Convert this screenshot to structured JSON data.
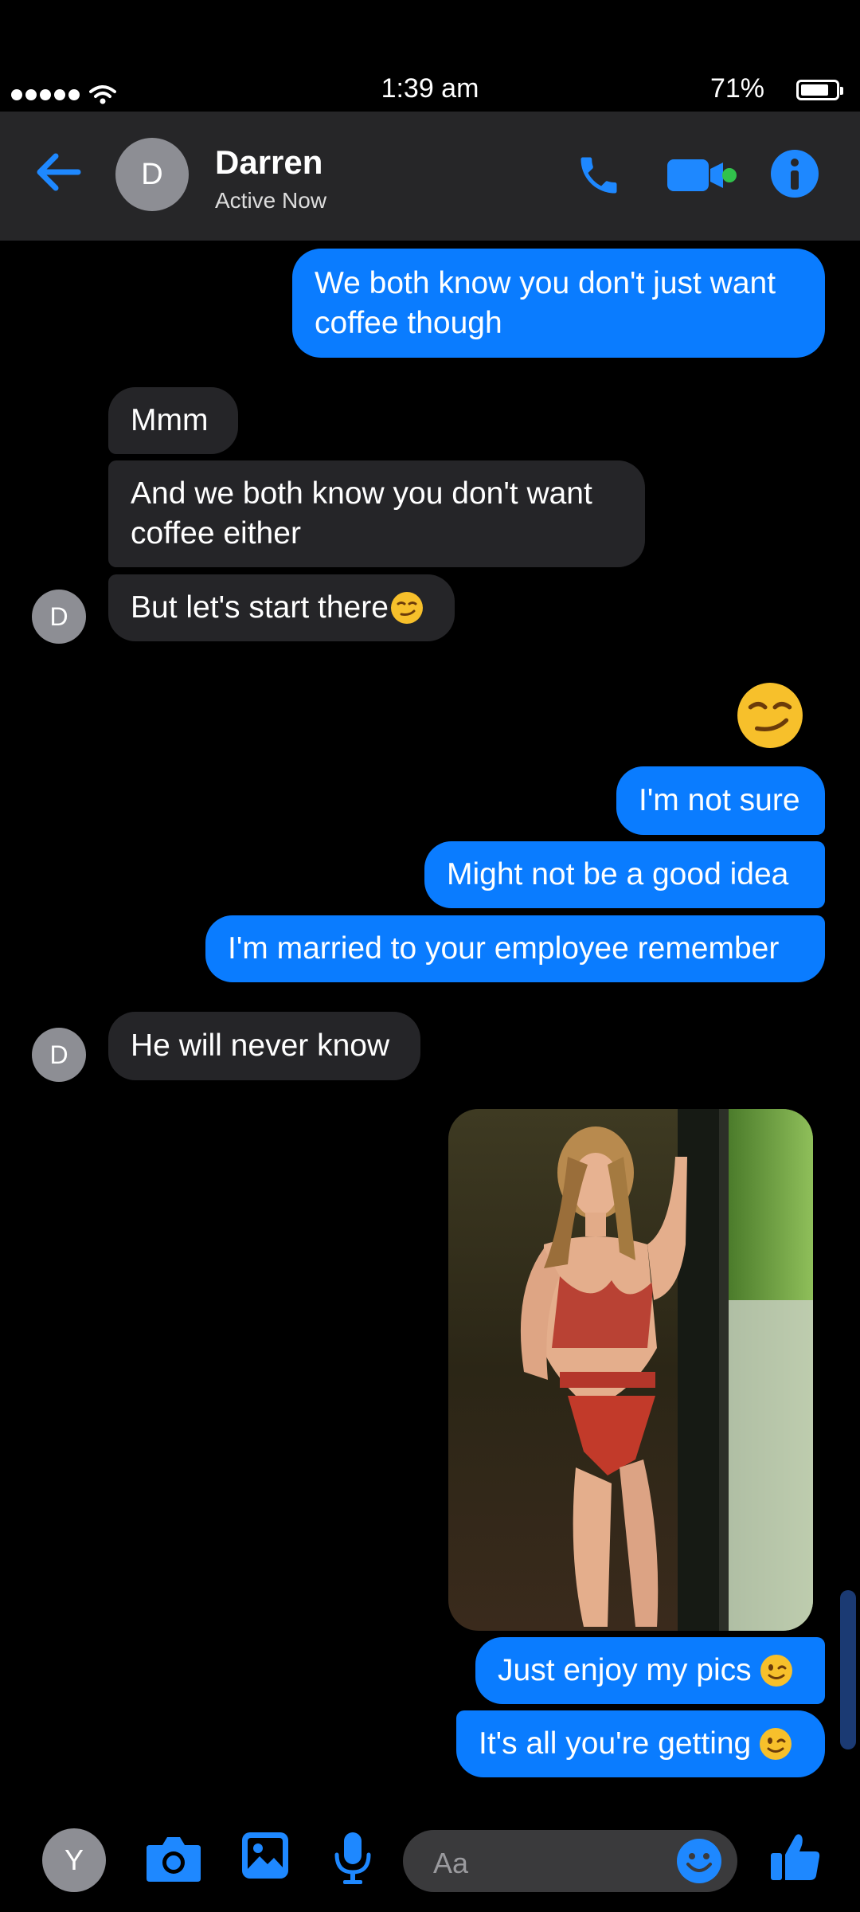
{
  "status_bar": {
    "time": "1:39 am",
    "battery": "71%",
    "battery_level": 0.71,
    "icons": [
      "signal-dots-icon",
      "wifi-icon",
      "battery-icon"
    ]
  },
  "header": {
    "avatar_initial": "D",
    "name": "Darren",
    "status": "Active Now",
    "icons": [
      "back-arrow-icon",
      "phone-icon",
      "video-camera-icon",
      "info-icon"
    ]
  },
  "messages": [
    {
      "from": "me",
      "text_lines": [
        "We both know you don't just want",
        "coffee though"
      ]
    },
    {
      "from": "them",
      "text": "Mmm"
    },
    {
      "from": "them",
      "text_lines": [
        "And we both know you don't want",
        "coffee either"
      ]
    },
    {
      "from": "them",
      "text": "But let's start there",
      "emoji": "smirk"
    },
    {
      "from": "me",
      "emoji_only": "smirk"
    },
    {
      "from": "me",
      "text": "I'm not sure"
    },
    {
      "from": "me",
      "text": "Might not be a good idea"
    },
    {
      "from": "me",
      "text": "I'm married to your employee remember"
    },
    {
      "from": "them",
      "text": "He will never know"
    },
    {
      "from": "me",
      "type": "photo"
    },
    {
      "from": "me",
      "text": "Just enjoy my pics",
      "emoji": "wink"
    },
    {
      "from": "me",
      "text": "It's all you're getting",
      "emoji": "wink"
    }
  ],
  "thread_avatar_initial": "D",
  "composer": {
    "avatar_initial": "Y",
    "placeholder": "Aa",
    "icons": [
      "camera-icon",
      "gallery-icon",
      "microphone-icon",
      "emoji-icon",
      "thumbs-up-icon"
    ]
  },
  "colors": {
    "accent": "#0a7cff",
    "incoming_bubble": "#252528",
    "header_bg": "#262628",
    "icon_blue": "#1e88ff",
    "active_green": "#31c24c"
  }
}
